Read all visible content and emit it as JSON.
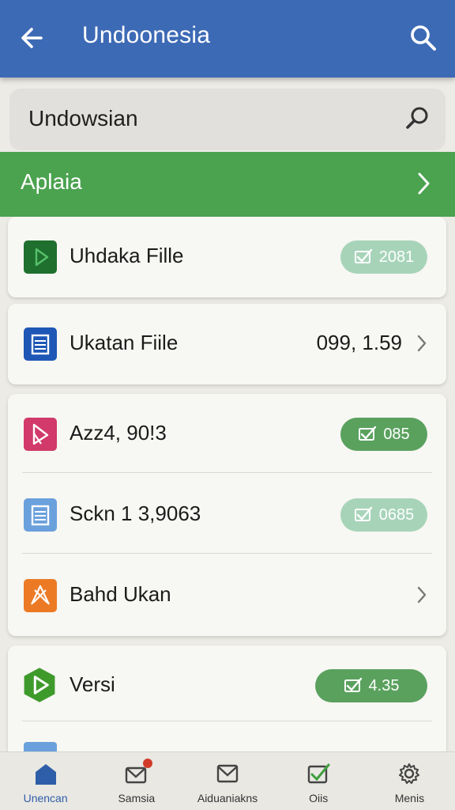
{
  "colors": {
    "appbar": "#3d6ab5",
    "section_band": "#4ba24f",
    "badge_light": "#a7d4b9",
    "badge_dark": "#5aa15e",
    "nav_active": "#2f5ea8"
  },
  "appbar": {
    "title": "Undoonesia",
    "back_icon": "arrow-left-icon",
    "search_icon": "search-icon"
  },
  "search": {
    "value": "Undowsian",
    "icon": "search-icon"
  },
  "section": {
    "label": "Aplaia",
    "icon": "chevron-right-icon"
  },
  "cards": [
    {
      "rows": [
        {
          "label": "Uhdaka Fille",
          "icon": "play-file-icon",
          "badge": "2081",
          "badge_style": "light"
        }
      ]
    },
    {
      "rows": [
        {
          "label": "Ukatan Fiile",
          "icon": "document-icon",
          "value": "099, 1.59",
          "chevron": true
        }
      ]
    },
    {
      "rows": [
        {
          "label": "Azz4, 90!3",
          "icon": "pink-app-icon",
          "badge": "085",
          "badge_style": "dark"
        },
        {
          "label": "Sckn 1 3,9063",
          "icon": "document-icon",
          "badge": "0685",
          "badge_style": "light"
        },
        {
          "label": "Bahd Ukan",
          "icon": "orange-app-icon",
          "chevron": true
        }
      ]
    },
    {
      "rows": [
        {
          "label": "Versi",
          "icon": "green-play-icon",
          "badge": "4.35",
          "badge_style": "dark"
        }
      ]
    }
  ],
  "bottom_nav": [
    {
      "label": "Unencan",
      "icon": "home-icon",
      "active": true
    },
    {
      "label": "Samsia",
      "icon": "mail-notification-icon"
    },
    {
      "label": "Aiduaniakns",
      "icon": "mail-icon"
    },
    {
      "label": "Oiis",
      "icon": "checkbox-icon"
    },
    {
      "label": "Menis",
      "icon": "gear-icon"
    }
  ]
}
